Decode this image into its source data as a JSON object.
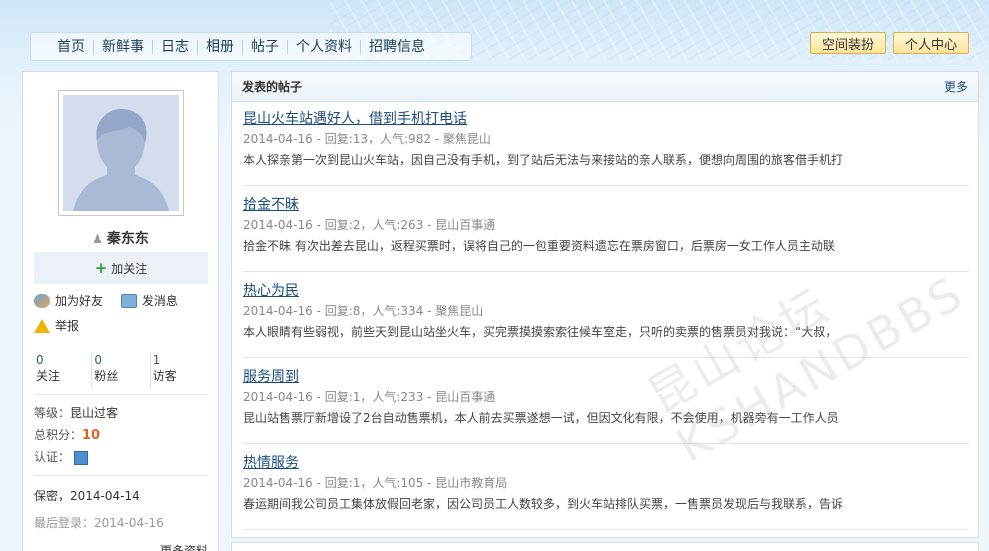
{
  "nav": {
    "items": [
      "首页",
      "新鲜事",
      "日志",
      "相册",
      "帖子",
      "个人资料",
      "招聘信息"
    ]
  },
  "top_buttons": {
    "decorate": "空间装扮",
    "personal_center": "个人中心"
  },
  "profile": {
    "name": "秦东东",
    "follow_label": "加关注",
    "add_friend": "加为好友",
    "send_message": "发消息",
    "report": "举报",
    "stats": [
      {
        "num": "0",
        "label": "关注"
      },
      {
        "num": "0",
        "label": "粉丝"
      },
      {
        "num": "1",
        "label": "访客"
      }
    ],
    "level_label": "等级：",
    "level_value": "昆山过客",
    "score_label": "总积分：",
    "score_value": "10",
    "cert_label": "认证：",
    "privacy_label": "保密，",
    "privacy_date": "2014-04-14",
    "last_login_label": "最后登录：",
    "last_login_date": "2014-04-16",
    "more_info": "更多资料"
  },
  "posts_panel": {
    "title": "发表的帖子",
    "more": "更多",
    "posts": [
      {
        "title": "昆山火车站遇好人，借到手机打电话",
        "meta": "2014-04-16 - 回复:13，人气:982 - 聚焦昆山",
        "body": "本人探亲第一次到昆山火车站，因自己没有手机，到了站后无法与来接站的亲人联系，便想向周围的旅客借手机打"
      },
      {
        "title": "拾金不昧",
        "meta": "2014-04-16 - 回复:2，人气:263 - 昆山百事通",
        "body": "拾金不昧 有次出差去昆山，返程买票时，误将自己的一包重要资料遗忘在票房窗口，后票房一女工作人员主动联"
      },
      {
        "title": "热心为民",
        "meta": "2014-04-16 - 回复:8，人气:334 - 聚焦昆山",
        "body": "本人眼睛有些弱视，前些天到昆山站坐火车，买完票摸摸索索往候车室走，只听的卖票的售票员对我说：“大叔，"
      },
      {
        "title": "服务周到",
        "meta": "2014-04-16 - 回复:1，人气:233 - 昆山百事通",
        "body": "昆山站售票厅新增设了2台自动售票机，本人前去买票遂想一试，但因文化有限，不会使用，机器旁有一工作人员"
      },
      {
        "title": "热情服务",
        "meta": "2014-04-16 - 回复:1，人气:105 - 昆山市教育局",
        "body": "春运期间我公司员工集体放假回老家，因公司员工人数较多，到火车站排队买票，一售票员发现后与我联系，告诉"
      }
    ]
  },
  "watermark": "昆山论坛 KSHANDBBS",
  "colors": {
    "link": "#1a4d80",
    "score": "#e0641c",
    "follow_plus": "#2fa62f"
  }
}
